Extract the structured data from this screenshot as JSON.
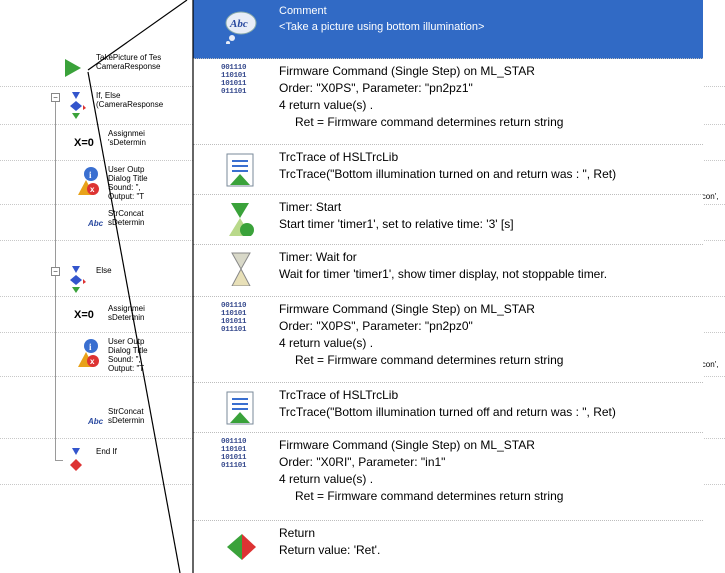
{
  "tree": {
    "rows": [
      {
        "lines": [
          "TakePicture of Tes",
          "CameraResponse"
        ],
        "icon": "play-arrow-icon"
      },
      {
        "lines": [
          "If, Else",
          "(CameraResponse"
        ],
        "icon": "if-else-icon"
      },
      {
        "lines": [
          "Assignmei",
          "'sDetermin"
        ],
        "icon": "assignment-icon",
        "badge": "X=0"
      },
      {
        "lines": [
          "User Outp",
          "Dialog Title",
          "Sound: \",",
          "Output: \"T"
        ],
        "icon": "user-output-icon",
        "tail": "icon',"
      },
      {
        "lines": [
          "StrConcat",
          "sDetermin"
        ],
        "icon": "str-concat-icon",
        "badge": "Abc"
      },
      {
        "lines": [
          "Else"
        ],
        "icon": "else-icon"
      },
      {
        "lines": [
          "Assignmei",
          "sDetermin"
        ],
        "icon": "assignment-icon",
        "badge": "X=0"
      },
      {
        "lines": [
          "User Outp",
          "Dialog Title",
          "Sound: \",",
          "Output: \"T"
        ],
        "icon": "user-output-icon",
        "tail": "icon',"
      },
      {
        "lines": [
          "StrConcat",
          "sDetermin"
        ],
        "icon": "str-concat-icon",
        "badge": "Abc"
      },
      {
        "lines": [
          "End If"
        ],
        "icon": "end-if-icon"
      }
    ]
  },
  "callout": {
    "steps": [
      {
        "icon": "comment-icon",
        "badge": "Abc",
        "selected": true,
        "lines": [
          "Comment",
          "<Take a picture using bottom illumination>"
        ]
      },
      {
        "icon": "firmware-binary-icon",
        "binary": [
          "001110",
          "110101",
          "101011",
          "011101"
        ],
        "lines": [
          "Firmware Command (Single Step) on ML_STAR",
          "Order: \"X0PS\", Parameter: \"pn2pz1\"",
          "4 return value(s) .",
          "Ret = Firmware command determines return string"
        ]
      },
      {
        "icon": "trace-icon",
        "lines": [
          "TrcTrace of HSLTrcLib",
          "TrcTrace(\"Bottom illumination turned on and return was : \", Ret)"
        ]
      },
      {
        "icon": "timer-start-icon",
        "lines": [
          "Timer: Start",
          "Start timer 'timer1', set to relative time: '3' [s]"
        ]
      },
      {
        "icon": "timer-wait-icon",
        "lines": [
          "Timer: Wait for",
          "Wait for timer 'timer1', show timer display, not stoppable timer."
        ]
      },
      {
        "icon": "firmware-binary-icon",
        "binary": [
          "001110",
          "110101",
          "101011",
          "011101"
        ],
        "lines": [
          "Firmware Command (Single Step) on ML_STAR",
          "Order: \"X0PS\", Parameter: \"pn2pz0\"",
          "4 return value(s) .",
          "Ret = Firmware command determines return string"
        ]
      },
      {
        "icon": "trace-icon",
        "lines": [
          "TrcTrace of HSLTrcLib",
          "TrcTrace(\"Bottom illumination turned off and return was : \", Ret)"
        ]
      },
      {
        "icon": "firmware-binary-icon",
        "binary": [
          "001110",
          "110101",
          "101011",
          "011101"
        ],
        "lines": [
          "Firmware Command (Single Step) on ML_STAR",
          "Order: \"X0RI\", Parameter: \"in1\"",
          "4 return value(s) .",
          "Ret = Firmware command determines return string"
        ]
      },
      {
        "icon": "return-icon",
        "lines": [
          "Return",
          "Return value: 'Ret'."
        ]
      }
    ]
  }
}
